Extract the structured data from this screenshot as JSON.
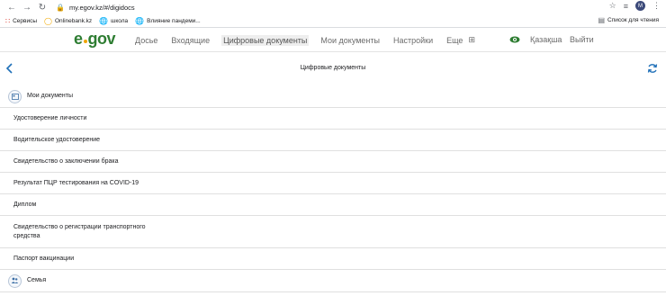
{
  "browser": {
    "url": "my.egov.kz/#/digidocs",
    "avatar_letter": "M",
    "bookmarks": [
      {
        "label": "Сервисы"
      },
      {
        "label": "Onlinebank.kz"
      },
      {
        "label": "школа"
      },
      {
        "label": "Влияние пандеми..."
      }
    ],
    "reading_list": "Список для чтения"
  },
  "header": {
    "logo_e": "e",
    "logo_rest": "gov",
    "nav": [
      "Досье",
      "Входящие",
      "Цифровые документы",
      "Мои документы",
      "Настройки",
      "Еще"
    ],
    "active_nav": "Цифровые документы",
    "language": "Қазақша",
    "logout": "Выйти",
    "accent": "#2e7d32"
  },
  "page": {
    "title": "Цифровые документы",
    "my_docs_section": "Мои документы",
    "documents": [
      "Удостоверение личности",
      "Водительское удостоверение",
      "Свидетельство о заключении брака",
      "Результат ПЦР тестирования на COVID-19",
      "Диплом",
      "Свидетельство о регистрации транспортного средства",
      "Паспорт вакцинации"
    ],
    "family_section": "Семья"
  }
}
